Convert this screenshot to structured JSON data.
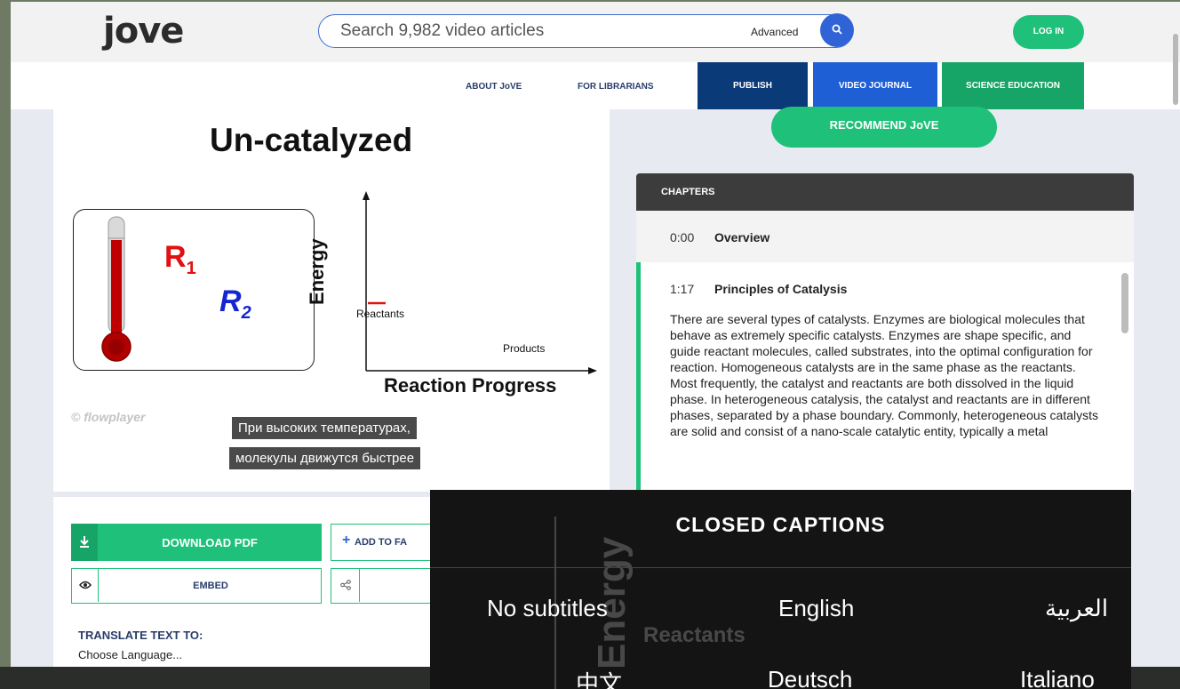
{
  "header": {
    "logo": "jove",
    "search_placeholder": "Search 9,982 video articles",
    "advanced_label": "Advanced",
    "login_label": "LOG IN"
  },
  "nav": {
    "about": "ABOUT JoVE",
    "librarians": "FOR LIBRARIANS",
    "publish": "PUBLISH",
    "video_journal": "VIDEO JOURNAL",
    "science_education": "SCIENCE EDUCATION"
  },
  "video": {
    "title": "Un-catalyzed",
    "r1": "R",
    "r1_sub": "1",
    "r2": "R",
    "r2_sub": "2",
    "y_label": "Energy",
    "reactants": "Reactants",
    "products": "Products",
    "x_label": "Reaction Progress",
    "watermark": "flowplayer",
    "subtitle_line1": "При высоких температурах,",
    "subtitle_line2": "молекулы движутся быстрее"
  },
  "actions": {
    "download_pdf": "DOWNLOAD PDF",
    "add_to_favorites": "ADD TO FA",
    "embed": "EMBED",
    "translate_label": "TRANSLATE TEXT TO:",
    "choose_language": "Choose Language..."
  },
  "recommend_label": "RECOMMEND JoVE",
  "chapters": {
    "header": "CHAPTERS",
    "items": [
      {
        "time": "0:00",
        "name": "Overview"
      },
      {
        "time": "1:17",
        "name": "Principles of Catalysis",
        "text": "There are several types of catalysts. Enzymes are biological molecules that behave as extremely specific catalysts. Enzymes are shape specific, and guide reactant molecules, called substrates, into the optimal configuration for reaction. Homogeneous catalysts are in the same phase as the reactants. Most frequently, the catalyst and reactants are both dissolved in the liquid phase. In heterogeneous catalysis, the catalyst and reactants are in different phases, separated by a phase boundary. Commonly, heterogeneous catalysts are solid and consist of a nano-scale catalytic entity, typically a metal"
      }
    ]
  },
  "closed_captions": {
    "title": "CLOSED CAPTIONS",
    "background_energy": "Energy",
    "background_reactants": "Reactants",
    "options": [
      "No subtitles",
      "English",
      "العربية",
      "中文",
      "Deutsch",
      "Italiano"
    ]
  },
  "colors": {
    "brand_green": "#1fc17a",
    "publish_navy": "#0b3a78",
    "video_journal_blue": "#1e5fd6",
    "science_education_green": "#17a567",
    "reactant_red": "#e21010",
    "reactant_blue": "#1326cf"
  }
}
